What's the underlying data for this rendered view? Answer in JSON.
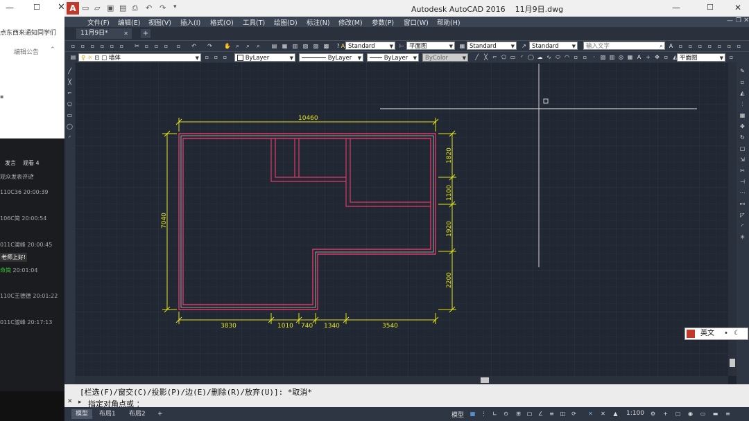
{
  "app": {
    "title": "Autodesk AutoCAD 2016",
    "file": "11月9日.dwg",
    "tab_label": "11月9日*",
    "tab_add": "+",
    "logo": "A"
  },
  "side_panel": {
    "top_text": "点东西来通知同学们",
    "edit_notice": "编辑公告",
    "tabs": [
      "发言",
      "观看 4"
    ],
    "filter": "观众发表评论",
    "messages": [
      {
        "user": "110C36",
        "time": "20:00:39"
      },
      {
        "user": "106C简",
        "time": "20:00:54"
      },
      {
        "user": "011C渡峰",
        "time": "20:00:45"
      },
      {
        "user": "老师上好!",
        "time": ""
      },
      {
        "user": "命简",
        "time": "20:01:04"
      },
      {
        "user": "110C王德德",
        "time": "20:01:22"
      },
      {
        "user": "011C渡峰",
        "time": "20:17:13"
      }
    ]
  },
  "menu": [
    "文件(F)",
    "编辑(E)",
    "视图(V)",
    "插入(I)",
    "格式(O)",
    "工具(T)",
    "绘图(D)",
    "标注(N)",
    "修改(M)",
    "参数(P)",
    "窗口(W)",
    "帮助(H)"
  ],
  "toolbar1": {
    "text_style": "Standard",
    "dim_style": "平面图",
    "table_style": "Standard",
    "ml_style": "Standard",
    "search_placeholder": "输入文字"
  },
  "toolbar2": {
    "layer": "墙体",
    "color": "ByLayer",
    "linetype": "ByLayer",
    "lineweight": "ByLayer",
    "plot_style": "ByColor",
    "view_combo": "平面图"
  },
  "drawing": {
    "dim_top": "10460",
    "dim_left": "7040",
    "dims_bottom": [
      "3830",
      "1010",
      "740",
      "1340",
      "3540"
    ],
    "dims_right": [
      "1820",
      "1100",
      "1920",
      "2200"
    ]
  },
  "command": {
    "line1": "[栏选(F)/窗交(C)/投影(P)/边(E)/删除(R)/放弃(U)]:  *取消*",
    "line2": "指定对角点或 ："
  },
  "layout_tabs": [
    "模型",
    "布局1",
    "布局2",
    "+"
  ],
  "status": {
    "model": "模型",
    "scale": "1:100"
  },
  "ime": {
    "mode": "英文"
  },
  "colors": {
    "canvas": "#212833",
    "wall": "#e03a66",
    "dimension": "#e5e51a",
    "crosshair": "#e6e6e6",
    "menubar": "#3b4453"
  }
}
